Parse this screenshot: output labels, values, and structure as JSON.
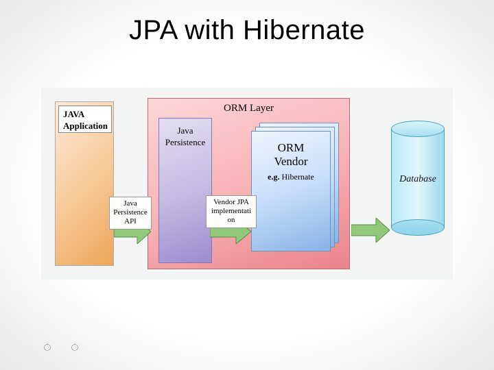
{
  "title": "JPA with Hibernate",
  "diagram": {
    "java_app": "JAVA\nApplication",
    "orm_layer_title": "ORM Layer",
    "java_persistence": "Java\nPersistence",
    "orm_vendor_title": "ORM\nVendor",
    "orm_vendor_eg_prefix": "e.g.",
    "orm_vendor_eg_value": "Hibernate",
    "database": "Database",
    "arrow1_label": "Java\nPersistence\nAPI",
    "arrow2_label": "Vendor JPA\nimplementati\non",
    "arrow_color_fill": "#8fc979",
    "arrow_color_stroke": "#5a8a4a"
  }
}
